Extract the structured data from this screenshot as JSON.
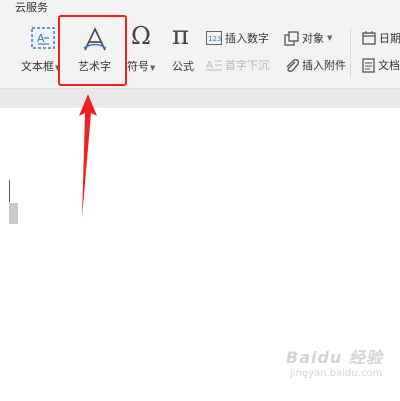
{
  "tab": {
    "label": "云服务"
  },
  "toolbar": {
    "text_box": "文本框",
    "word_art": "艺术字",
    "symbol": "符号",
    "formula": "公式",
    "insert_number": "插入数字",
    "first_letter_sink": "首字下沉",
    "object": "对象",
    "insert_attachment": "插入附件",
    "date_partial": "日期",
    "document_partial": "文档"
  },
  "watermark": {
    "brand": "Baidu 经验",
    "url": "jingyan.baidu.com"
  },
  "colors": {
    "highlight": "#ee2222",
    "arrow": "#ee2222",
    "ribbon_bg": "#f3f3f3"
  }
}
